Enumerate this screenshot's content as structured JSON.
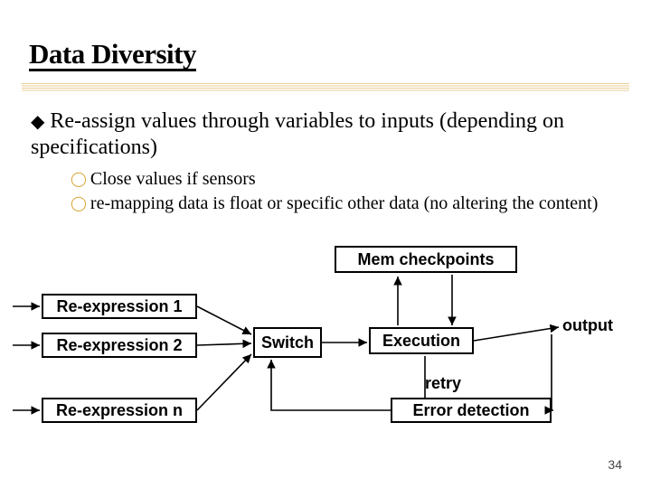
{
  "title": "Data Diversity",
  "bullet_main": "Re-assign values through variables to inputs (depending on specifications)",
  "sub_bullets": [
    "Close values if sensors",
    "re-mapping data is float or specific other data (no altering the content)"
  ],
  "boxes": {
    "mem": "Mem checkpoints",
    "re1": "Re-expression 1",
    "re2": "Re-expression 2",
    "ren": "Re-expression n",
    "switch": "Switch",
    "exec": "Execution",
    "errdet": "Error detection"
  },
  "labels": {
    "output": "output",
    "retry": "retry"
  },
  "page_num": "34"
}
